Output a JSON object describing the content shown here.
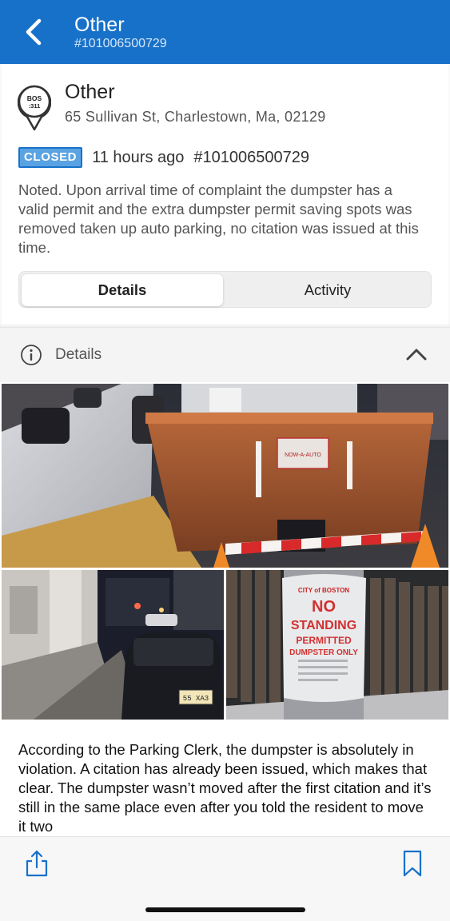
{
  "topbar": {
    "title": "Other",
    "subtitle": "#101006500729"
  },
  "header": {
    "logo_text_line1": "BOS",
    "logo_text_line2": ":311",
    "service": "Other",
    "address": "65 Sullivan St, Charlestown, Ma, 02129",
    "status_badge": "CLOSED",
    "time_ago": "11 hours ago",
    "case_id": "#101006500729",
    "description": "Noted. Upon arrival time of complaint the dumpster has a valid permit and the extra dumpster permit saving spots was removed taken up auto parking, no citation was issued at this time."
  },
  "tabs": {
    "details": "Details",
    "activity": "Activity"
  },
  "details_section": {
    "label": "Details"
  },
  "photos": {
    "dumpster_sign": "NOW-A-AUTO",
    "plate": "55 XA3",
    "sign_line1": "CITY of BOSTON",
    "sign_line2": "NO",
    "sign_line3": "STANDING",
    "sign_line4": "PERMITTED",
    "sign_line5": "DUMPSTER ONLY"
  },
  "body_text": "According to the Parking Clerk, the dumpster is absolutely in violation. A citation has already been issued, which makes that clear. The dumpster wasn’t moved after the first citation and it’s still in the same place even after you told the resident to move it two",
  "colors": {
    "brand_blue": "#1871c9",
    "badge_blue": "#5aa3e3"
  },
  "icons": {
    "back": "chevron-left-icon",
    "info": "info-icon",
    "collapse": "chevron-up-icon",
    "share": "share-icon",
    "bookmark": "bookmark-icon"
  }
}
